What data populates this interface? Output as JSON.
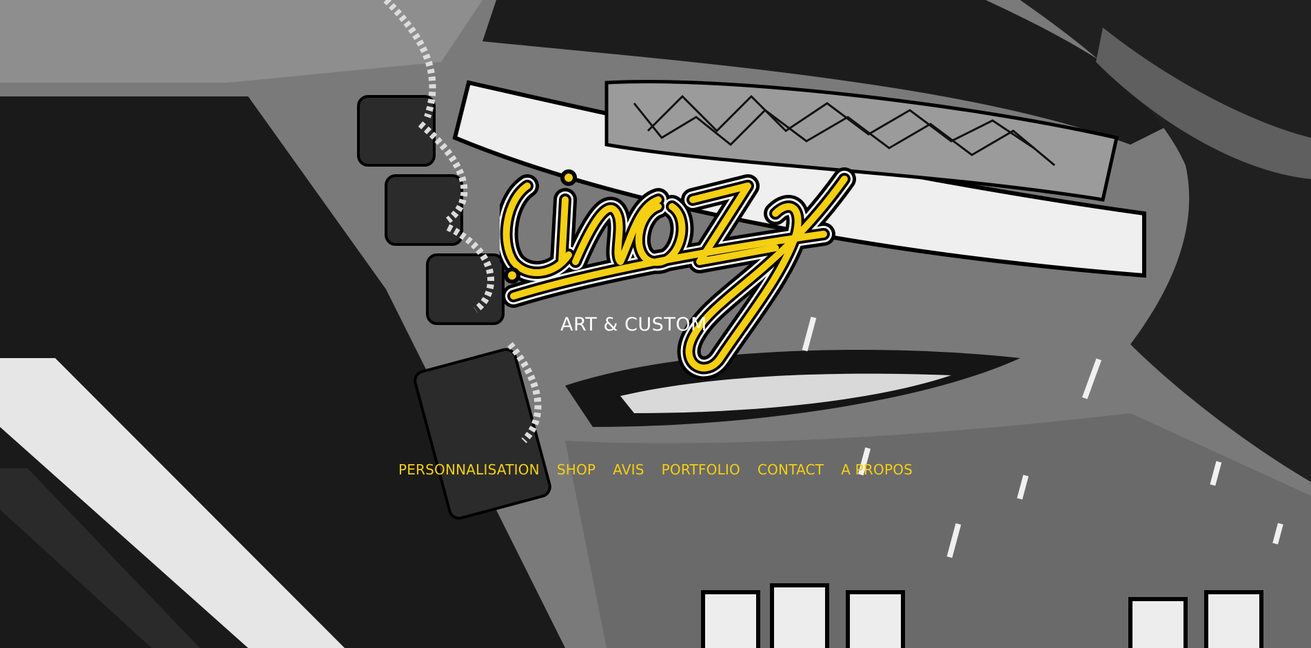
{
  "brand": {
    "logo_text": "Cinoz",
    "tagline": "ART & CUSTOM"
  },
  "nav": {
    "items": [
      {
        "label": "PERSONNALISATION",
        "icon": ""
      },
      {
        "label": "SHOP",
        "icon": ""
      },
      {
        "label": "AVIS",
        "icon": ""
      },
      {
        "label": "PORTFOLIO",
        "icon": ""
      },
      {
        "label": "CONTACT",
        "icon": ""
      },
      {
        "label": "A PROPOS",
        "icon": ""
      }
    ]
  },
  "colors": {
    "accent": "#f5cf12",
    "logo_outline": "#000000",
    "background_artwork": "grayscale"
  },
  "background": {
    "description_icon": "sneaker-artwork-image"
  }
}
